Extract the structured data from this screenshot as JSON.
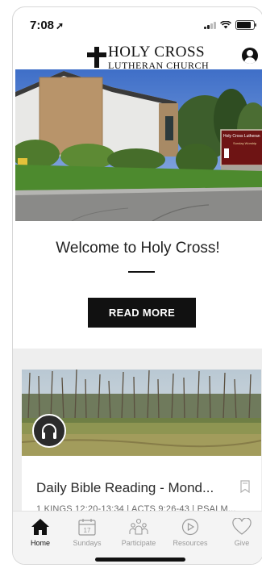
{
  "status_bar": {
    "time": "7:08",
    "location_arrow": "➚"
  },
  "header": {
    "logo_line1": "HOLY CROSS",
    "logo_line2": "LUTHERAN CHURCH",
    "account_icon": "account-circle-icon"
  },
  "hero": {
    "sign_text": "Holy Cross Lutheran",
    "sign_subtext": "Sunday Worship"
  },
  "welcome": {
    "title": "Welcome to Holy Cross!",
    "button_label": "READ MORE"
  },
  "card": {
    "title": "Daily Bible Reading - Mond...",
    "subtitle": "1 KINGS 12:20-13:34 | ACTS 9:26-43 | PSALM..."
  },
  "tabs": [
    {
      "label": "Home",
      "icon": "home-icon",
      "active": true
    },
    {
      "label": "Sundays",
      "icon": "calendar-icon",
      "calendar_day": "17"
    },
    {
      "label": "Participate",
      "icon": "people-icon"
    },
    {
      "label": "Resources",
      "icon": "play-icon"
    },
    {
      "label": "Give",
      "icon": "heart-icon"
    }
  ],
  "colors": {
    "accent": "#111111",
    "tab_inactive": "#9a9a9a",
    "feed_bg": "#eeeeee"
  }
}
